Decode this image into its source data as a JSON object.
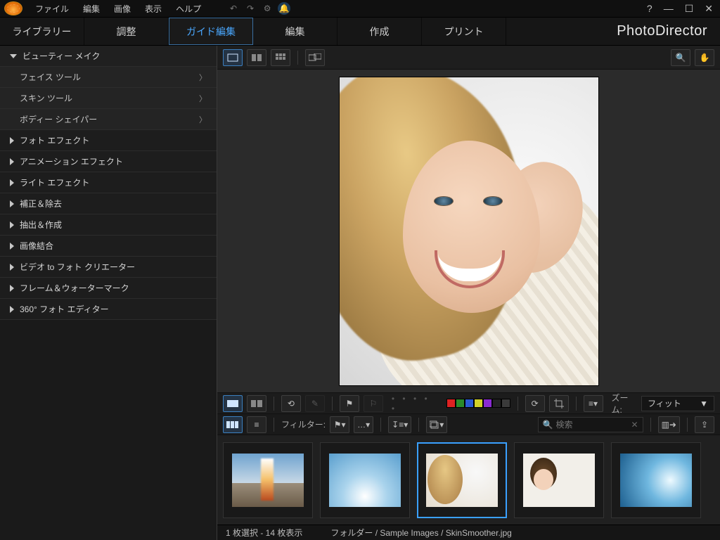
{
  "menu": {
    "file": "ファイル",
    "edit": "編集",
    "image": "画像",
    "view": "表示",
    "help": "ヘルプ"
  },
  "brand": "PhotoDirector",
  "modes": {
    "library": "ライブラリー",
    "adjust": "調整",
    "guided": "ガイド編集",
    "edit": "編集",
    "create": "作成",
    "print": "プリント"
  },
  "sidebar": {
    "top": "ビューティー メイク",
    "subs": [
      {
        "label": "フェイス ツール"
      },
      {
        "label": "スキン ツール"
      },
      {
        "label": "ボディー シェイパー"
      }
    ],
    "groups": [
      "フォト エフェクト",
      "アニメーション エフェクト",
      "ライト エフェクト",
      "補正＆除去",
      "抽出＆作成",
      "画像結合",
      "ビデオ to フォト クリエーター",
      "フレーム＆ウォーターマーク",
      "360° フォト エディター"
    ]
  },
  "toolbar2": {
    "zoom_label": "ズーム:",
    "zoom_value": "フィット",
    "colors": [
      "#d22",
      "#2a8a2a",
      "#2a5ad2",
      "#d2d22a",
      "#8a2ad2",
      "#222",
      "#3a3a3a"
    ]
  },
  "toolbar3": {
    "filter_label": "フィルター:",
    "search_placeholder": "検索"
  },
  "status": {
    "selection": "1 枚選択 - 14 枚表示",
    "path": "フォルダー / Sample Images / SkinSmoother.jpg"
  }
}
